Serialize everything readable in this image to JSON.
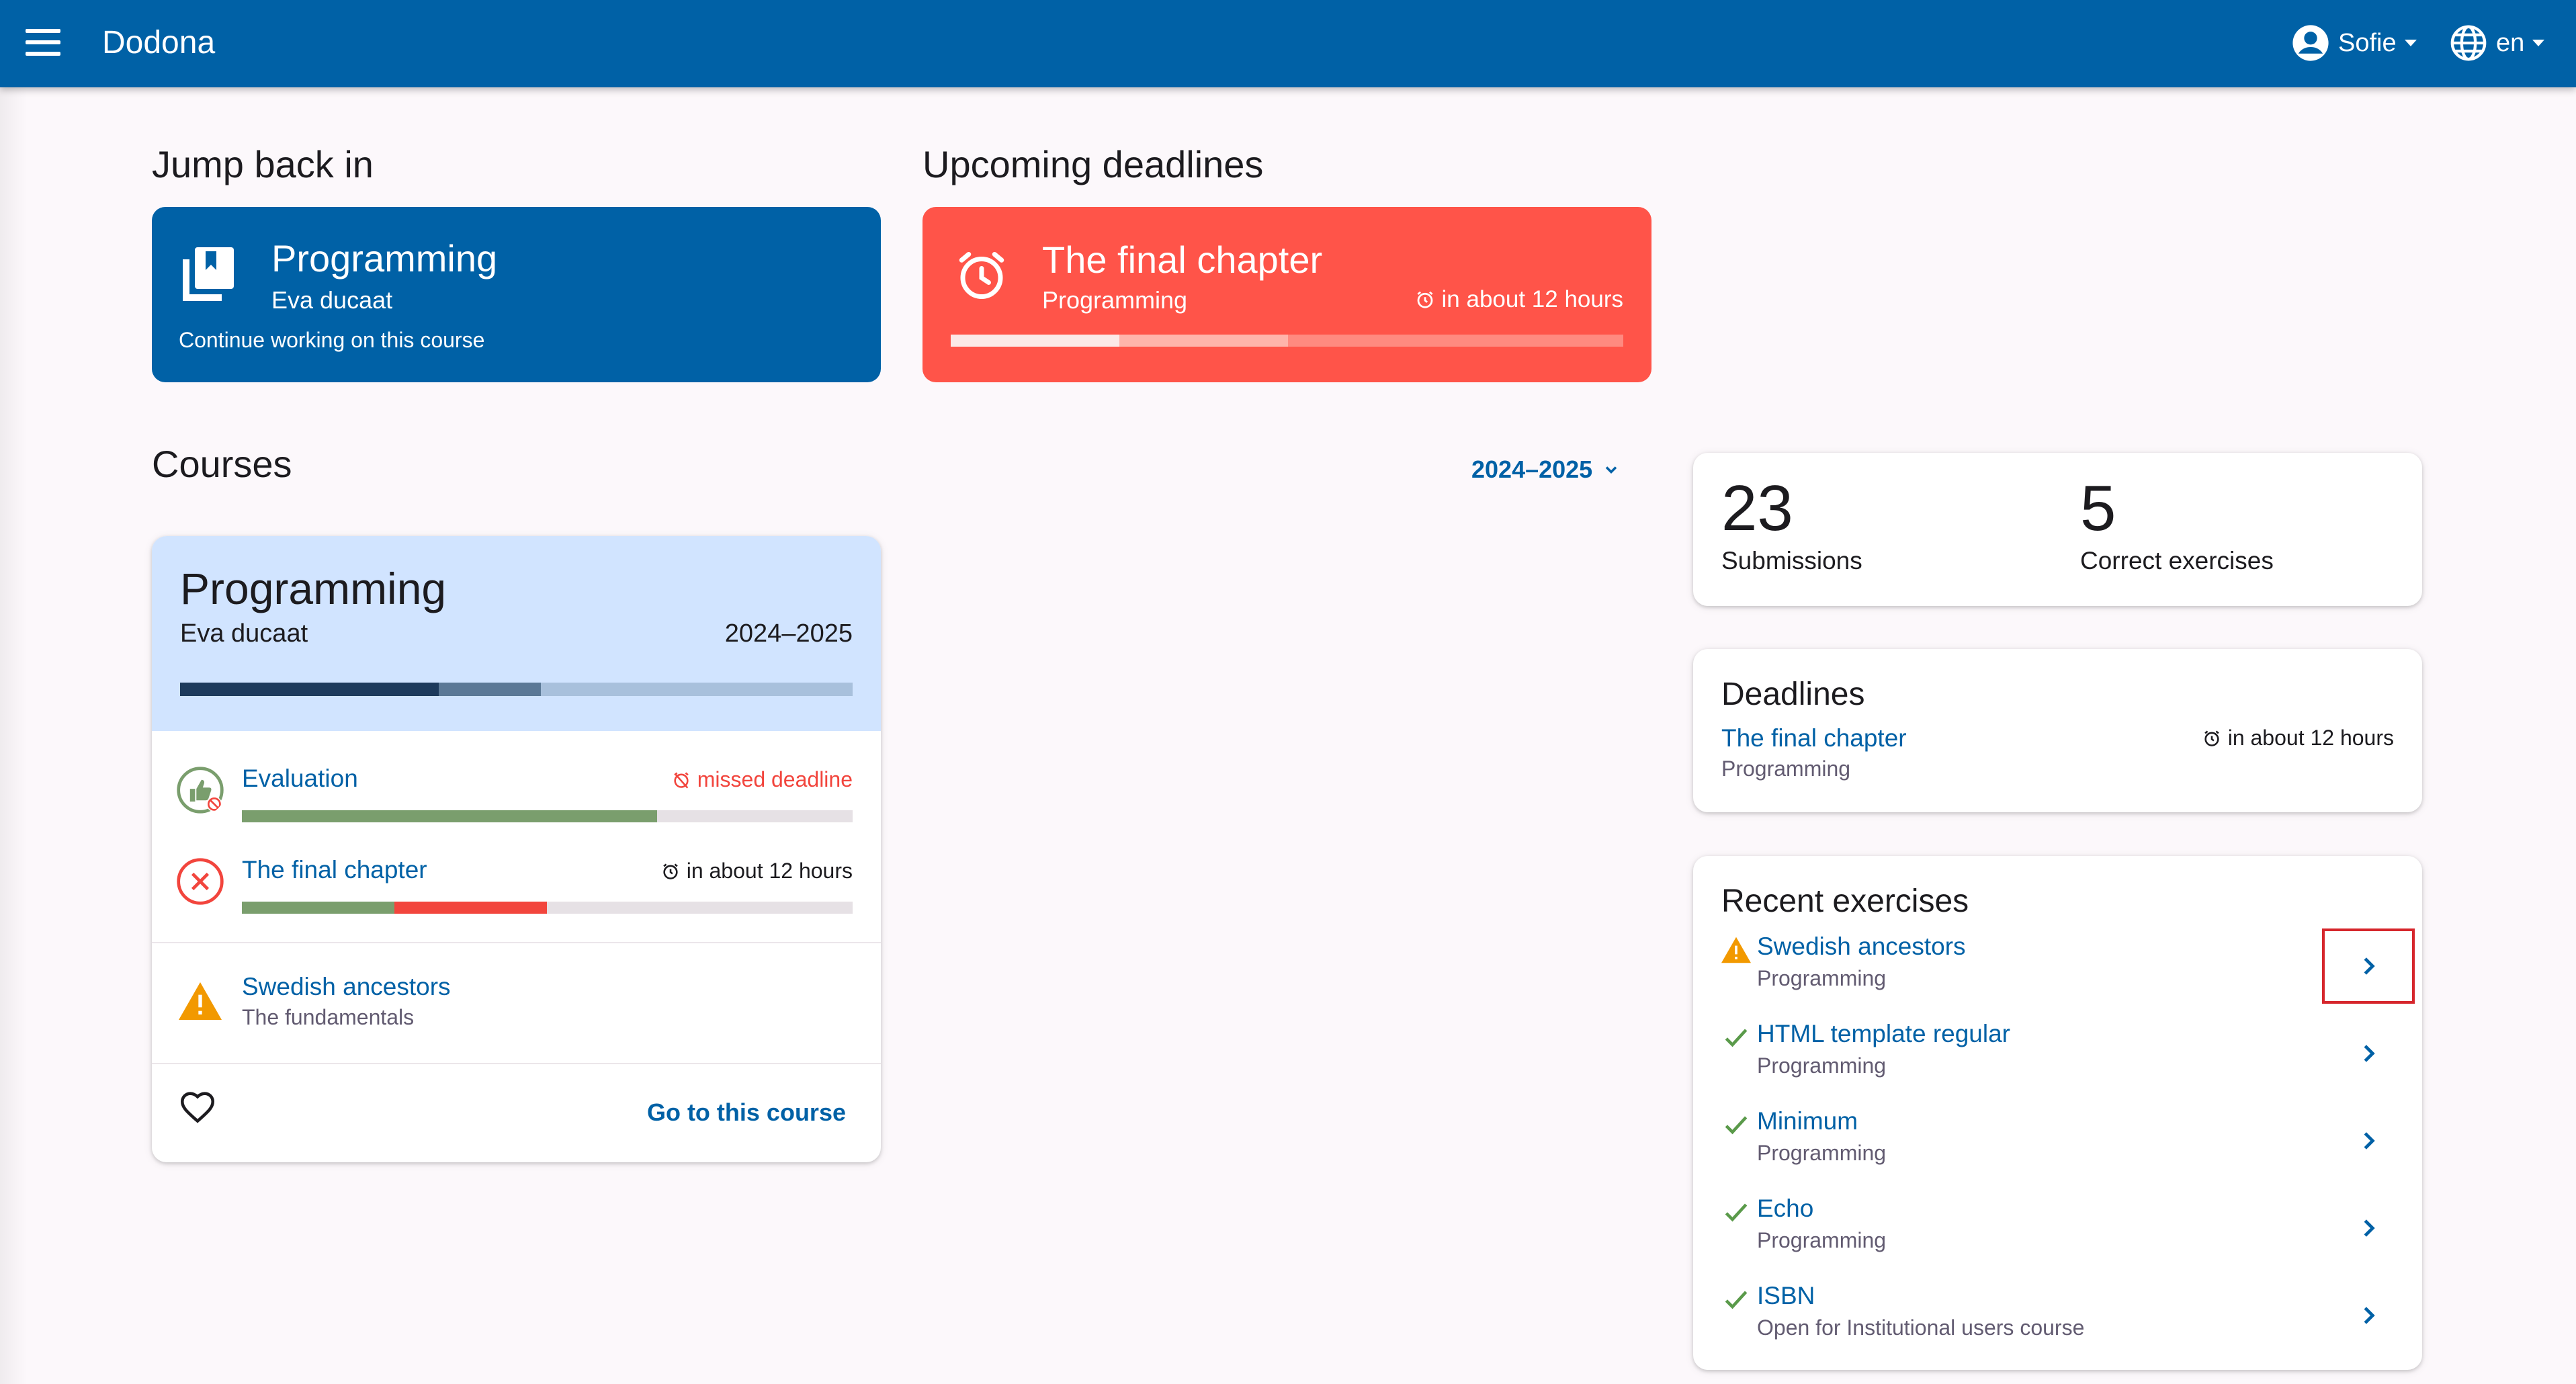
{
  "navbar": {
    "brand": "Dodona",
    "user": "Sofie",
    "language": "en",
    "color": "#0061a6"
  },
  "jump_back": {
    "heading": "Jump back in",
    "course": "Programming",
    "teacher": "Eva ducaat",
    "cta": "Continue working on this course"
  },
  "upcoming": {
    "heading": "Upcoming deadlines",
    "title": "The final chapter",
    "course": "Programming",
    "time": "in about 12 hours",
    "color": "#ff5449"
  },
  "courses": {
    "heading": "Courses",
    "year_filter": "2024–2025",
    "card": {
      "title": "Programming",
      "teacher": "Eva ducaat",
      "year": "2024–2025",
      "series": [
        {
          "name": "Evaluation",
          "status": "missed deadline",
          "correct_fraction": 0.68,
          "wrong_fraction": 0.0
        },
        {
          "name": "The final chapter",
          "status": "in about 12 hours",
          "correct_fraction": 0.25,
          "wrong_fraction": 0.25
        }
      ],
      "todo": {
        "name": "Swedish ancestors",
        "sub": "The fundamentals"
      },
      "go_label": "Go to this course"
    }
  },
  "stats": {
    "submissions": {
      "value": "23",
      "label": "Submissions"
    },
    "correct": {
      "value": "5",
      "label": "Correct exercises"
    }
  },
  "deadlines": {
    "title": "Deadlines",
    "item": {
      "name": "The final chapter",
      "course": "Programming",
      "time": "in about 12 hours"
    }
  },
  "recent": {
    "title": "Recent exercises",
    "items": [
      {
        "name": "Swedish ancestors",
        "course": "Programming",
        "status": "warning"
      },
      {
        "name": "HTML template regular",
        "course": "Programming",
        "status": "correct"
      },
      {
        "name": "Minimum",
        "course": "Programming",
        "status": "correct"
      },
      {
        "name": "Echo",
        "course": "Programming",
        "status": "correct"
      },
      {
        "name": "ISBN",
        "course": "Open for Institutional users course",
        "status": "correct"
      }
    ]
  }
}
